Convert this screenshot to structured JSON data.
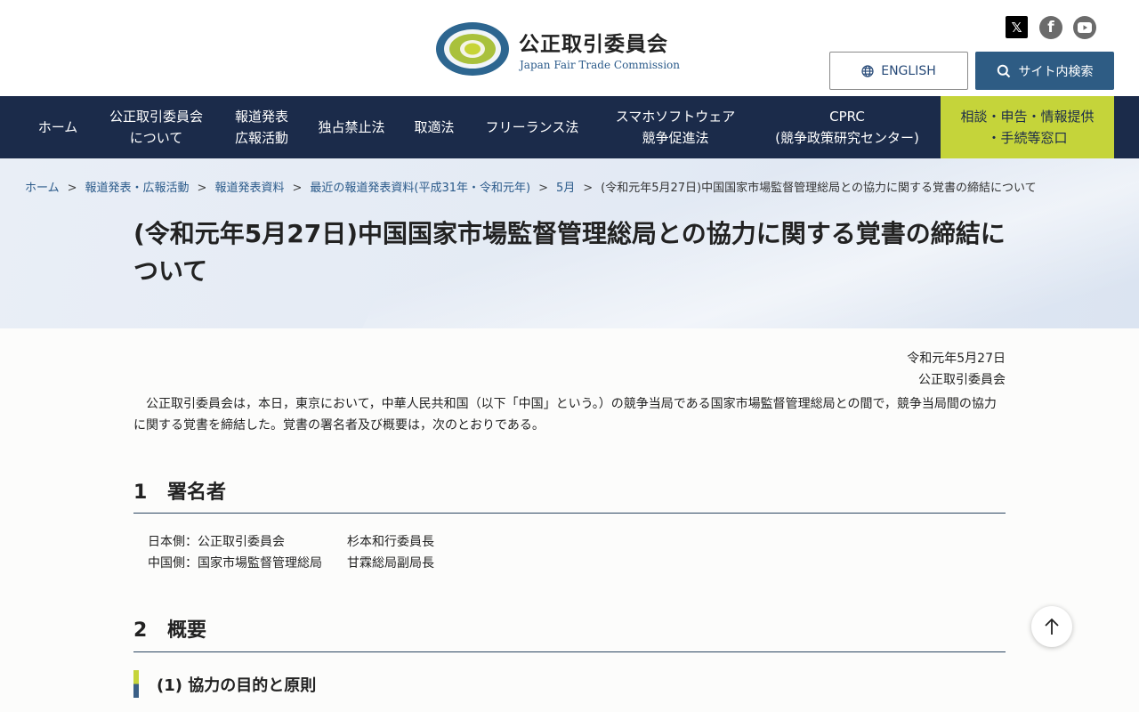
{
  "header": {
    "site_title": "公正取引委員会",
    "site_subtitle": "Japan Fair Trade Commission",
    "logo_ring_text": "JAPAN FAIR TRADE COMMISSION",
    "social": {
      "x": "𝕏",
      "facebook": "f"
    },
    "english_label": "ENGLISH",
    "search_label": "サイト内検索"
  },
  "nav": {
    "items": [
      {
        "line1": "ホーム",
        "line2": ""
      },
      {
        "line1": "公正取引委員会",
        "line2": "について"
      },
      {
        "line1": "報道発表",
        "line2": "広報活動"
      },
      {
        "line1": "独占禁止法",
        "line2": ""
      },
      {
        "line1": "取適法",
        "line2": ""
      },
      {
        "line1": "フリーランス法",
        "line2": ""
      },
      {
        "line1": "スマホソフトウェア",
        "line2": "競争促進法"
      },
      {
        "line1": "CPRC",
        "line2": "(競争政策研究センター)"
      }
    ],
    "consult": {
      "line1": "相談・申告・情報提供",
      "line2": "・手続等窓口"
    }
  },
  "breadcrumb": {
    "items": [
      "ホーム",
      "報道発表・広報活動",
      "報道発表資料",
      "最近の報道発表資料(平成31年・令和元年)",
      "5月"
    ],
    "current": "(令和元年5月27日)中国国家市場監督管理総局との協力に関する覚書の締結について",
    "separator": ">"
  },
  "page": {
    "title": "(令和元年5月27日)中国国家市場監督管理総局との協力に関する覚書の締結について",
    "date": "令和元年5月27日",
    "issuer": "公正取引委員会",
    "intro": "公正取引委員会は，本日，東京において，中華人民共和国（以下「中国」という。）の競争当局である国家市場監督管理総局との間で，競争当局間の協力に関する覚書を締結した。覚書の署名者及び概要は，次のとおりである。",
    "section1": {
      "num": "1",
      "title": "署名者"
    },
    "signatories": [
      {
        "side": "日本側：公正取引委員会",
        "name": "杉本和行委員長"
      },
      {
        "side": "中国側：国家市場監督管理総局",
        "name": "甘霖総局副局長"
      }
    ],
    "section2": {
      "num": "2",
      "title": "概要"
    },
    "subsection": "(1) 協力の目的と原則"
  },
  "colors": {
    "nav_bg": "#1b2b4a",
    "accent_green": "#c5d43a",
    "search_button": "#2e5c84",
    "link": "#2a5a8a"
  }
}
